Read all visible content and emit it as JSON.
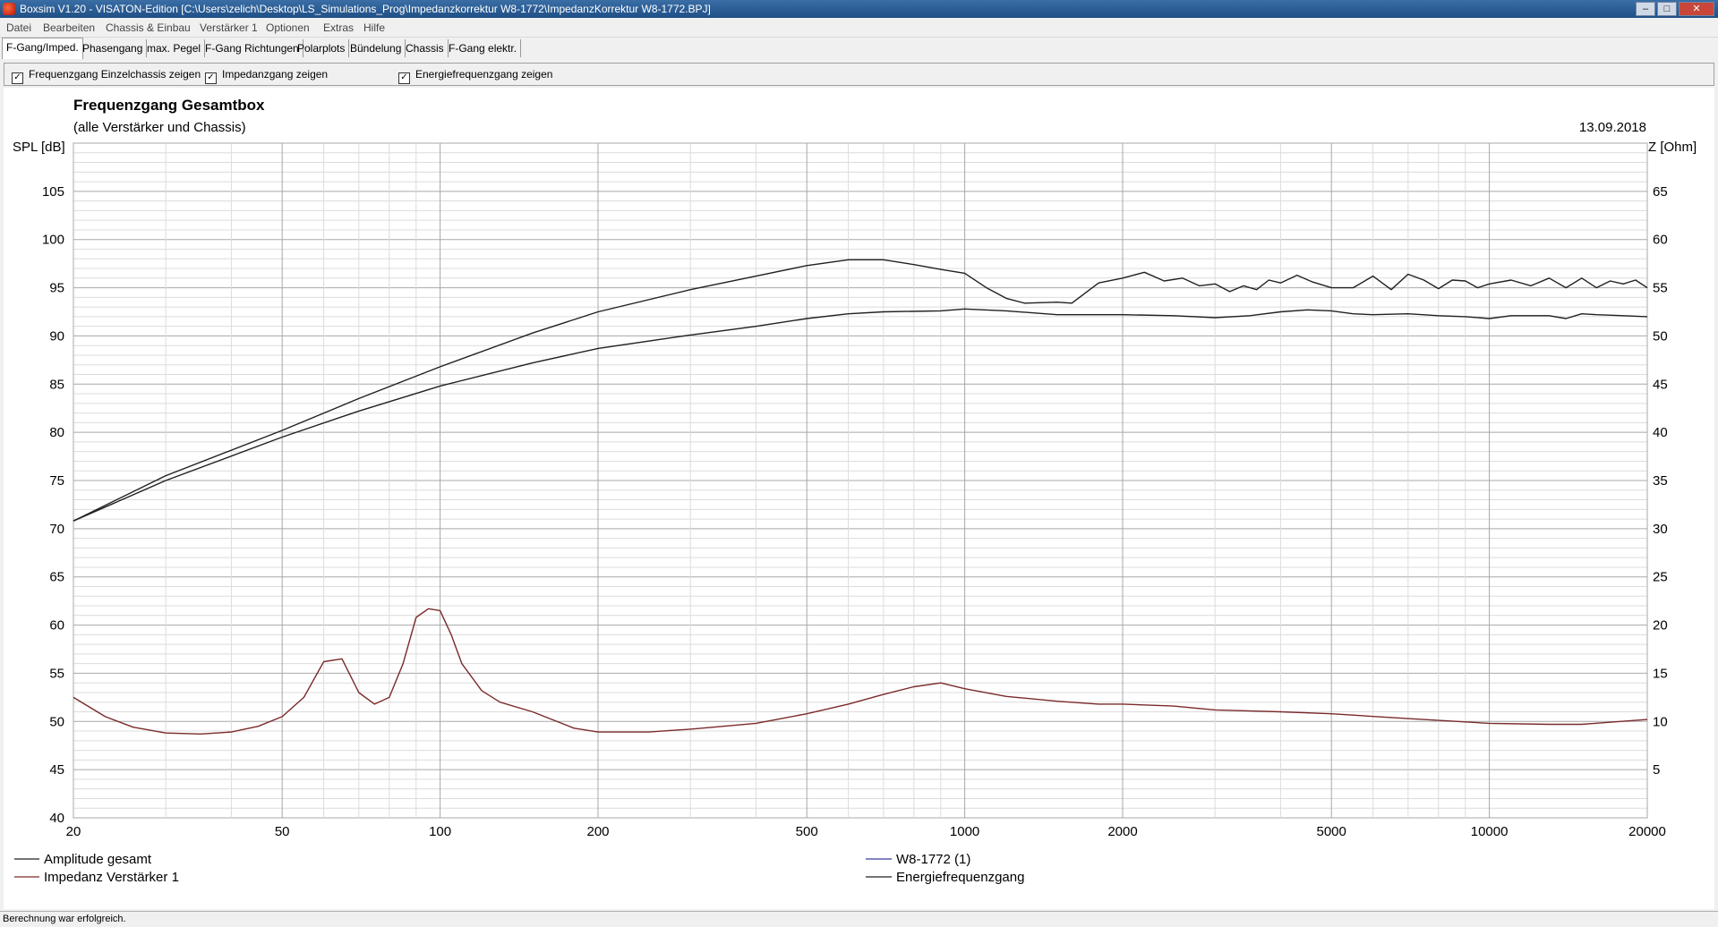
{
  "window": {
    "title": "Boxsim V1.20 - VISATON-Edition [C:\\Users\\zelich\\Desktop\\LS_Simulations_Prog\\Impedanzkorrektur W8-1772\\ImpedanzKorrektur W8-1772.BPJ]",
    "buttons": {
      "minimize": "–",
      "maximize": "□",
      "close": "✕"
    }
  },
  "menu": [
    "Datei",
    "Bearbeiten",
    "Chassis & Einbau",
    "Verstärker 1",
    "Optionen",
    "Extras",
    "Hilfe"
  ],
  "tabs": [
    "F-Gang/Imped.",
    "Phasengang",
    "max. Pegel",
    "F-Gang Richtungen",
    "Polarplots",
    "Bündelung",
    "Chassis",
    "F-Gang elektr."
  ],
  "options": [
    {
      "label": "Frequenzgang Einzelchassis zeigen",
      "checked": true
    },
    {
      "label": "Impedanzgang zeigen",
      "checked": true
    },
    {
      "label": "Energiefrequenzgang zeigen",
      "checked": true
    }
  ],
  "status": "Berechnung war erfolgreich.",
  "chart_data": {
    "type": "line",
    "title": "Frequenzgang Gesamtbox",
    "subtitle": "(alle Verstärker und Chassis)",
    "date": "13.09.2018",
    "ylabel": "SPL [dB]",
    "y2label": "Z [Ohm]",
    "xscale": "log",
    "xlim": [
      20,
      20000
    ],
    "ylim": [
      40,
      110
    ],
    "y2lim": [
      0,
      70
    ],
    "xticks": [
      20,
      50,
      100,
      200,
      500,
      1000,
      2000,
      5000,
      10000,
      20000
    ],
    "xtick_labels": [
      "20",
      "50",
      "100",
      "200",
      "500",
      "1000",
      "2000",
      "5000",
      "10000",
      "20000"
    ],
    "yticks": [
      40,
      45,
      50,
      55,
      60,
      65,
      70,
      75,
      80,
      85,
      90,
      95,
      100,
      105
    ],
    "y2ticks": [
      5,
      10,
      15,
      20,
      25,
      30,
      35,
      40,
      45,
      50,
      55,
      60,
      65
    ],
    "grid": true,
    "legend": [
      {
        "name": "Amplitude gesamt",
        "color": "#202020",
        "position": "bottom-left"
      },
      {
        "name": "Impedanz Verstärker 1",
        "color": "#7a2a2a",
        "position": "bottom-left"
      },
      {
        "name": "W8-1772 (1)",
        "color": "#3a3a9a",
        "position": "bottom-center"
      },
      {
        "name": "Energiefrequenzgang",
        "color": "#202020",
        "position": "bottom-center"
      }
    ],
    "series": [
      {
        "name": "Amplitude gesamt",
        "axis": "left",
        "color": "#202020",
        "x": [
          20,
          30,
          50,
          70,
          100,
          150,
          200,
          300,
          400,
          500,
          600,
          700,
          800,
          900,
          1000,
          1100,
          1200,
          1300,
          1500,
          1600,
          1800,
          2000,
          2200,
          2400,
          2600,
          2800,
          3000,
          3200,
          3400,
          3600,
          3800,
          4000,
          4300,
          4600,
          5000,
          5500,
          6000,
          6500,
          7000,
          7500,
          8000,
          8500,
          9000,
          9500,
          10000,
          11000,
          12000,
          13000,
          14000,
          15000,
          16000,
          17000,
          18000,
          19000,
          20000
        ],
        "y": [
          70.8,
          75.5,
          80.2,
          83.5,
          86.8,
          90.3,
          92.5,
          94.8,
          96.2,
          97.3,
          97.9,
          97.9,
          97.4,
          96.9,
          96.5,
          95.0,
          93.9,
          93.4,
          93.5,
          93.4,
          95.5,
          96.0,
          96.6,
          95.7,
          96.0,
          95.2,
          95.4,
          94.6,
          95.2,
          94.8,
          95.8,
          95.5,
          96.3,
          95.6,
          95.0,
          95.0,
          96.2,
          94.8,
          96.4,
          95.8,
          94.9,
          95.8,
          95.7,
          95.0,
          95.4,
          95.8,
          95.2,
          96.0,
          95.0,
          96.0,
          95.0,
          95.7,
          95.4,
          95.8,
          95.0
        ]
      },
      {
        "name": "Energiefrequenzgang",
        "axis": "left",
        "color": "#202020",
        "x": [
          20,
          30,
          50,
          70,
          100,
          150,
          200,
          300,
          400,
          500,
          600,
          700,
          900,
          1000,
          1200,
          1500,
          2000,
          2500,
          3000,
          3500,
          4000,
          4500,
          5000,
          5500,
          6000,
          7000,
          8000,
          9000,
          10000,
          11000,
          12000,
          13000,
          14000,
          15000,
          16000,
          18000,
          20000
        ],
        "y": [
          70.8,
          75.0,
          79.5,
          82.2,
          84.8,
          87.2,
          88.7,
          90.1,
          91.0,
          91.8,
          92.3,
          92.5,
          92.6,
          92.8,
          92.6,
          92.2,
          92.2,
          92.1,
          91.9,
          92.1,
          92.5,
          92.7,
          92.6,
          92.3,
          92.2,
          92.3,
          92.1,
          92.0,
          91.8,
          92.1,
          92.1,
          92.1,
          91.8,
          92.3,
          92.2,
          92.1,
          92.0
        ]
      },
      {
        "name": "Impedanz Verstärker 1",
        "axis": "right",
        "color": "#7a2a2a",
        "x": [
          20,
          23,
          26,
          30,
          35,
          40,
          45,
          50,
          55,
          60,
          65,
          70,
          75,
          80,
          85,
          90,
          95,
          100,
          105,
          110,
          120,
          130,
          150,
          180,
          200,
          250,
          300,
          400,
          500,
          600,
          700,
          800,
          900,
          1000,
          1200,
          1500,
          1800,
          2000,
          2500,
          3000,
          4000,
          5000,
          7000,
          10000,
          13000,
          15000,
          20000
        ],
        "y": [
          12.5,
          10.5,
          9.4,
          8.8,
          8.7,
          8.9,
          9.5,
          10.5,
          12.5,
          16.2,
          16.5,
          13.0,
          11.8,
          12.5,
          16.0,
          20.8,
          21.7,
          21.5,
          19.0,
          16.0,
          13.2,
          12.0,
          11.0,
          9.3,
          8.9,
          8.9,
          9.2,
          9.8,
          10.8,
          11.8,
          12.8,
          13.6,
          14.0,
          13.4,
          12.6,
          12.1,
          11.8,
          11.8,
          11.6,
          11.2,
          11.0,
          10.8,
          10.3,
          9.8,
          9.7,
          9.7,
          10.2
        ]
      }
    ]
  }
}
